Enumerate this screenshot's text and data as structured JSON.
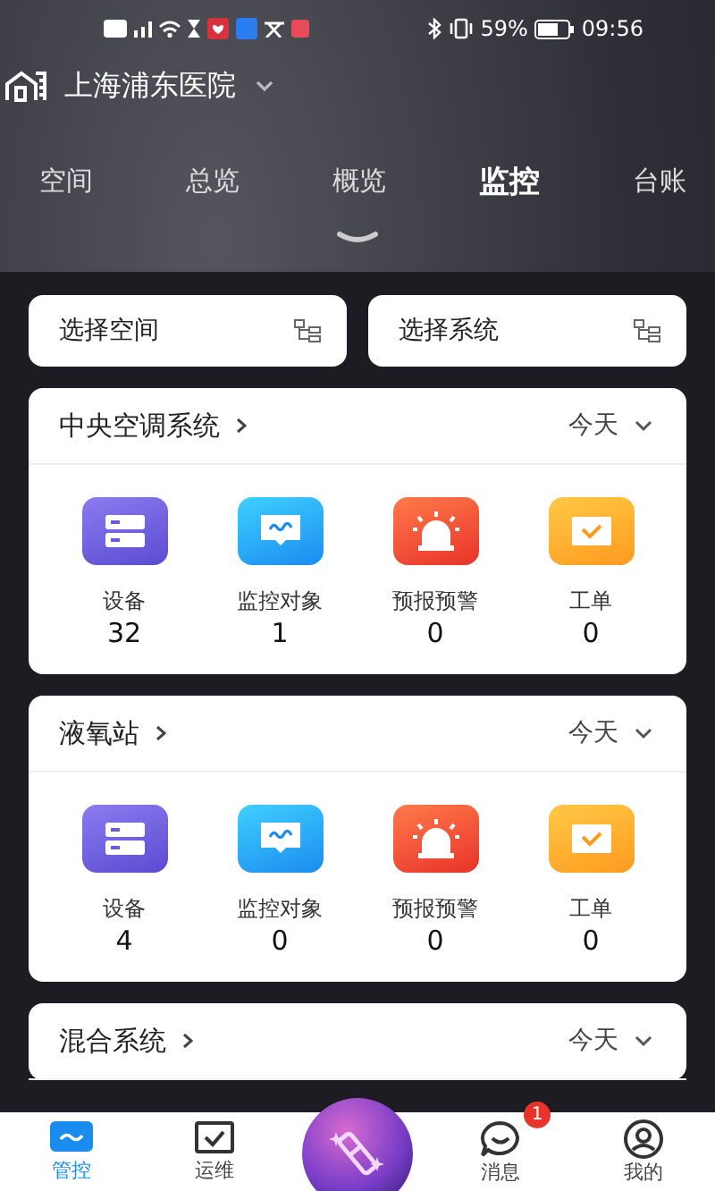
{
  "status_bar": {
    "battery": "59%",
    "time": "09:56"
  },
  "header": {
    "title": "上海浦东医院"
  },
  "tabs": [
    {
      "label": "空间",
      "selected": false
    },
    {
      "label": "总览",
      "selected": false
    },
    {
      "label": "概览",
      "selected": false
    },
    {
      "label": "监控",
      "selected": true
    },
    {
      "label": "台账",
      "selected": false
    }
  ],
  "selectors": [
    {
      "label": "选择空间"
    },
    {
      "label": "选择系统"
    }
  ],
  "systems": [
    {
      "name": "中央空调系统",
      "period": "今天",
      "stats": [
        {
          "kind": "device",
          "label": "设备",
          "value": "32"
        },
        {
          "kind": "monitor",
          "label": "监控对象",
          "value": "1"
        },
        {
          "kind": "alarm",
          "label": "预报预警",
          "value": "0"
        },
        {
          "kind": "order",
          "label": "工单",
          "value": "0"
        }
      ]
    },
    {
      "name": "液氧站",
      "period": "今天",
      "stats": [
        {
          "kind": "device",
          "label": "设备",
          "value": "4"
        },
        {
          "kind": "monitor",
          "label": "监控对象",
          "value": "0"
        },
        {
          "kind": "alarm",
          "label": "预报预警",
          "value": "0"
        },
        {
          "kind": "order",
          "label": "工单",
          "value": "0"
        }
      ]
    },
    {
      "name": "混合系统",
      "period": "今天"
    }
  ],
  "bottom_nav": [
    {
      "kind": "control",
      "label": "管控",
      "selected": true
    },
    {
      "kind": "ops",
      "label": "运维",
      "selected": false
    },
    {
      "kind": "center"
    },
    {
      "kind": "message",
      "label": "消息",
      "selected": false,
      "badge": "1"
    },
    {
      "kind": "profile",
      "label": "我的",
      "selected": false
    }
  ]
}
